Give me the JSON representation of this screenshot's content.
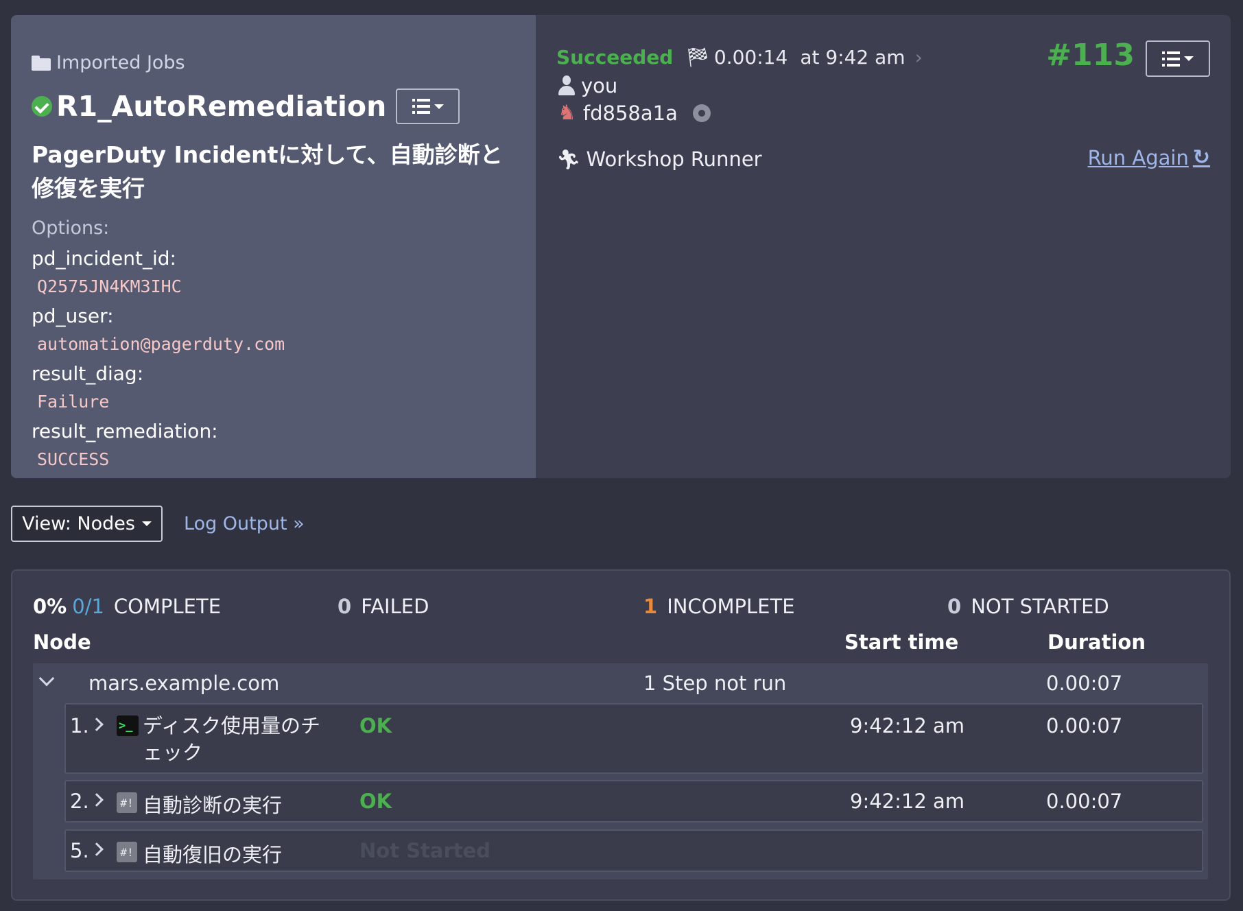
{
  "job": {
    "group": "Imported Jobs",
    "name": "R1_AutoRemediation",
    "description": "PagerDuty Incidentに対して、自動診断と修復を実行",
    "options_label": "Options:",
    "options": [
      {
        "key": "pd_incident_id:",
        "value": "Q2575JN4KM3IHC"
      },
      {
        "key": "pd_user:",
        "value": "automation@pagerduty.com"
      },
      {
        "key": "result_diag:",
        "value": "Failure"
      },
      {
        "key": "result_remediation:",
        "value": "SUCCESS"
      }
    ]
  },
  "execution": {
    "status": "Succeeded",
    "duration": "0.00:14",
    "at_time": "at 9:42 am",
    "user": "you",
    "commit": "fd858a1a",
    "runner": "Workshop Runner",
    "number": "#113",
    "run_again": "Run Again"
  },
  "view": {
    "view_button": "View: Nodes",
    "log_link": "Log Output »"
  },
  "summary": {
    "percent": "0%",
    "fraction": "0/1",
    "complete_label": "COMPLETE",
    "failed_count": "0",
    "failed_label": "FAILED",
    "incomplete_count": "1",
    "incomplete_label": "INCOMPLETE",
    "not_started_count": "0",
    "not_started_label": "NOT STARTED"
  },
  "table_headers": {
    "node": "Node",
    "start_time": "Start time",
    "duration": "Duration"
  },
  "node": {
    "name": "mars.example.com",
    "status": "1 Step not run",
    "duration": "0.00:07"
  },
  "steps": [
    {
      "number": "1.",
      "name": "ディスク使用量のチェック",
      "status": "OK",
      "start": "9:42:12 am",
      "duration": "0.00:07",
      "icon": "terminal-icon"
    },
    {
      "number": "2.",
      "name": "自動診断の実行",
      "status": "OK",
      "start": "9:42:12 am",
      "duration": "0.00:07",
      "icon": "script-icon"
    },
    {
      "number": "5.",
      "name": "自動復旧の実行",
      "status": "Not Started",
      "start": "",
      "duration": "",
      "icon": "script-icon"
    }
  ],
  "colors": {
    "success": "#4caf50",
    "link": "#9fb6e8",
    "incomplete": "#e98a3a",
    "fraction": "#5aa7d9"
  }
}
